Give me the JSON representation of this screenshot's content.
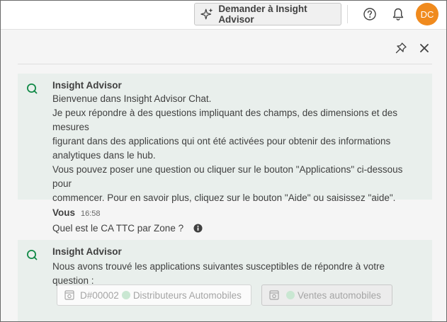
{
  "topbar": {
    "ask_button_label": "Demander à Insight Advisor",
    "avatar_initials": "DC"
  },
  "colors": {
    "avatar": "#f08a1d",
    "assistant_bubble": "#e9efec",
    "brand_green": "#128a48"
  },
  "messages": [
    {
      "author": "Insight Advisor",
      "lines": [
        "Bienvenue dans Insight Advisor Chat.",
        "Je peux répondre à des questions impliquant des champs, des dimensions et des mesures",
        "figurant dans des applications qui ont été activées pour obtenir des informations",
        "analytiques dans le hub.",
        "Vous pouvez poser une question ou cliquer sur le bouton \"Applications\" ci-dessous pour",
        "commencer. Pour en savoir plus, cliquez sur le bouton \"Aide\" ou saisissez \"aide\"."
      ]
    },
    {
      "author": "Vous",
      "time": "16:58",
      "text": "Quel est le CA TTC par Zone ?"
    },
    {
      "author": "Insight Advisor",
      "text": "Nous avons trouvé les applications suivantes susceptibles de répondre à votre question :",
      "apps": [
        {
          "id": "D#00002",
          "name": "Distributeurs Automobiles"
        },
        {
          "name": "Ventes automobiles"
        }
      ]
    }
  ],
  "icons": [
    "sparkle-icon",
    "help-icon",
    "bell-icon",
    "pin-icon",
    "close-icon",
    "qlik-q-icon",
    "info-icon",
    "app-icon"
  ]
}
